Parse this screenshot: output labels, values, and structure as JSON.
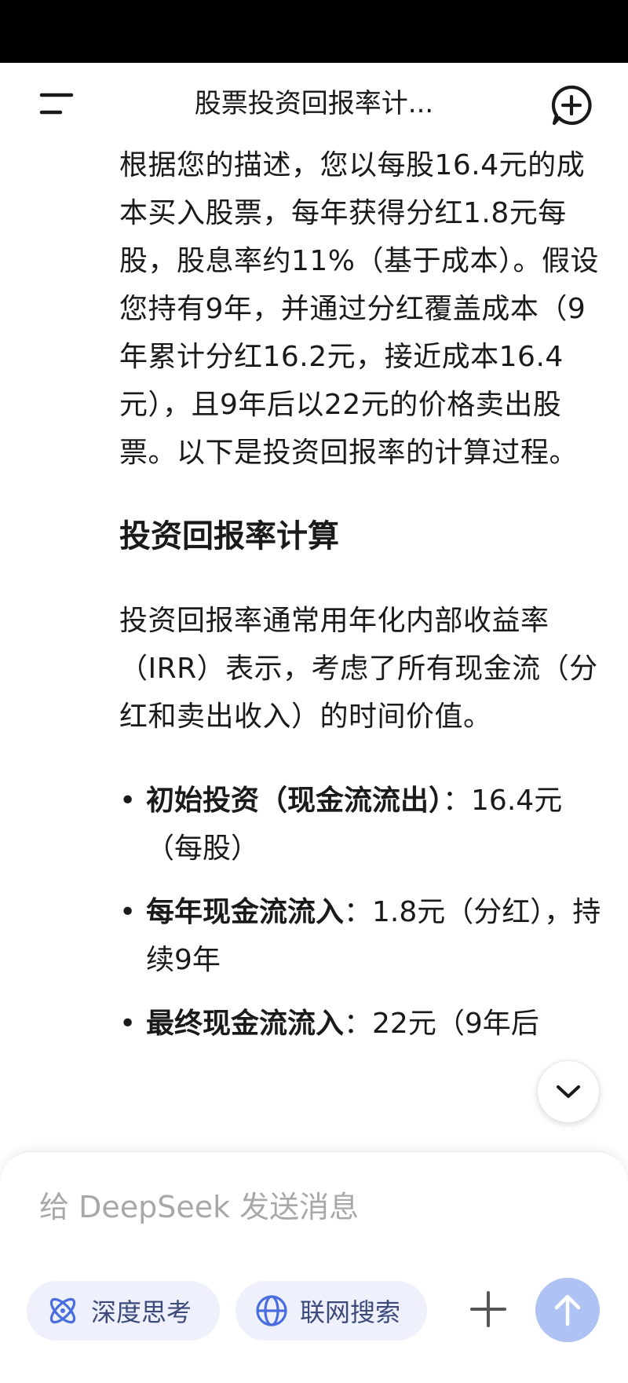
{
  "header": {
    "title": "股票投资回报率计...",
    "menu_icon": "menu-icon",
    "new_chat_icon": "new-chat-icon"
  },
  "message": {
    "intro": "根据您的描述，您以每股16.4元的成本买入股票，每年获得分红1.8元每股，股息率约11%（基于成本）。假设您持有9年，并通过分红覆盖成本（9年累计分红16.2元，接近成本16.4元），且9年后以22元的价格卖出股票。以下是投资回报率的计算过程。",
    "heading": "投资回报率计算",
    "explain": "投资回报率通常用年化内部收益率（IRR）表示，考虑了所有现金流（分红和卖出收入）的时间价值。",
    "bullets": [
      {
        "label": "初始投资（现金流流出）",
        "value": "16.4元（每股）"
      },
      {
        "label": "每年现金流流入",
        "value": "1.8元（分红），持续9年"
      },
      {
        "label": "最终现金流流入",
        "value": "22元（9年后"
      }
    ],
    "bullet_separator": "："
  },
  "composer": {
    "placeholder": "给 DeepSeek 发送消息",
    "deep_think_label": "深度思考",
    "web_search_label": "联网搜索",
    "send_color": "#aec2f4"
  },
  "colors": {
    "accent": "#4a6ee0",
    "chip_bg": "#eef1fb",
    "text": "#1a1a1a"
  }
}
